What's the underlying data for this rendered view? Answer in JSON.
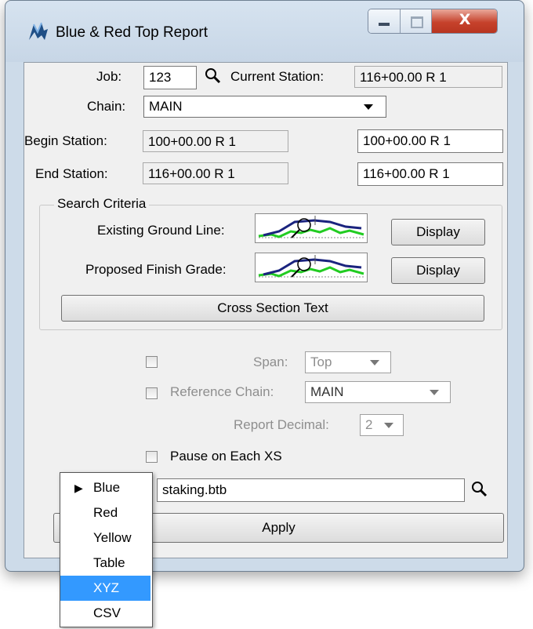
{
  "window": {
    "title": "Blue & Red Top Report",
    "close_glyph": "X"
  },
  "form": {
    "job_label": "Job:",
    "job_value": "123",
    "current_station_label": "Current Station:",
    "current_station_value": "116+00.00 R 1",
    "chain_label": "Chain:",
    "chain_value": "MAIN",
    "begin_station_label": "Begin Station:",
    "begin_station_value": "100+00.00 R 1",
    "begin_station_edit": "100+00.00 R 1",
    "end_station_label": "End Station:",
    "end_station_value": "116+00.00 R 1",
    "end_station_edit": "116+00.00 R 1"
  },
  "search_criteria": {
    "title": "Search Criteria",
    "existing_ground_label": "Existing Ground Line:",
    "proposed_finish_label": "Proposed Finish Grade:",
    "display_label": "Display",
    "cross_section_label": "Cross Section Text"
  },
  "options": {
    "span_label": "Span:",
    "span_value": "Top",
    "reference_chain_label": "Reference Chain:",
    "reference_chain_value": "MAIN",
    "report_decimal_label": "Report Decimal:",
    "report_decimal_value": "2",
    "pause_label": "Pause on Each XS",
    "output_file": "staking.btb",
    "apply_label": "Apply"
  },
  "dropdown": {
    "items": [
      "Blue",
      "Red",
      "Yellow",
      "Table",
      "XYZ",
      "CSV"
    ],
    "current_marker": "▶",
    "selected": "XYZ"
  },
  "colors": {
    "selection": "#3399ff",
    "frame": "#cddbe9",
    "close_button": "#c6422c"
  },
  "icons": [
    "app-icon",
    "search-icon",
    "profile-graph-icon",
    "dropdown-arrow-icon",
    "minimize-icon",
    "maximize-icon",
    "close-icon"
  ]
}
